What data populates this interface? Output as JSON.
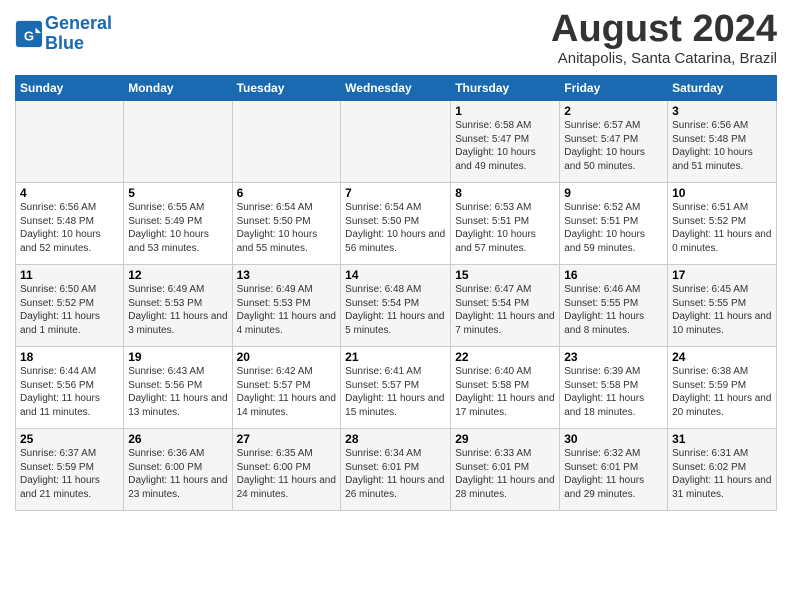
{
  "header": {
    "logo_line1": "General",
    "logo_line2": "Blue",
    "month": "August 2024",
    "location": "Anitapolis, Santa Catarina, Brazil"
  },
  "weekdays": [
    "Sunday",
    "Monday",
    "Tuesday",
    "Wednesday",
    "Thursday",
    "Friday",
    "Saturday"
  ],
  "weeks": [
    [
      {
        "day": "",
        "info": ""
      },
      {
        "day": "",
        "info": ""
      },
      {
        "day": "",
        "info": ""
      },
      {
        "day": "",
        "info": ""
      },
      {
        "day": "1",
        "info": "Sunrise: 6:58 AM\nSunset: 5:47 PM\nDaylight: 10 hours and 49 minutes."
      },
      {
        "day": "2",
        "info": "Sunrise: 6:57 AM\nSunset: 5:47 PM\nDaylight: 10 hours and 50 minutes."
      },
      {
        "day": "3",
        "info": "Sunrise: 6:56 AM\nSunset: 5:48 PM\nDaylight: 10 hours and 51 minutes."
      }
    ],
    [
      {
        "day": "4",
        "info": "Sunrise: 6:56 AM\nSunset: 5:48 PM\nDaylight: 10 hours and 52 minutes."
      },
      {
        "day": "5",
        "info": "Sunrise: 6:55 AM\nSunset: 5:49 PM\nDaylight: 10 hours and 53 minutes."
      },
      {
        "day": "6",
        "info": "Sunrise: 6:54 AM\nSunset: 5:50 PM\nDaylight: 10 hours and 55 minutes."
      },
      {
        "day": "7",
        "info": "Sunrise: 6:54 AM\nSunset: 5:50 PM\nDaylight: 10 hours and 56 minutes."
      },
      {
        "day": "8",
        "info": "Sunrise: 6:53 AM\nSunset: 5:51 PM\nDaylight: 10 hours and 57 minutes."
      },
      {
        "day": "9",
        "info": "Sunrise: 6:52 AM\nSunset: 5:51 PM\nDaylight: 10 hours and 59 minutes."
      },
      {
        "day": "10",
        "info": "Sunrise: 6:51 AM\nSunset: 5:52 PM\nDaylight: 11 hours and 0 minutes."
      }
    ],
    [
      {
        "day": "11",
        "info": "Sunrise: 6:50 AM\nSunset: 5:52 PM\nDaylight: 11 hours and 1 minute."
      },
      {
        "day": "12",
        "info": "Sunrise: 6:49 AM\nSunset: 5:53 PM\nDaylight: 11 hours and 3 minutes."
      },
      {
        "day": "13",
        "info": "Sunrise: 6:49 AM\nSunset: 5:53 PM\nDaylight: 11 hours and 4 minutes."
      },
      {
        "day": "14",
        "info": "Sunrise: 6:48 AM\nSunset: 5:54 PM\nDaylight: 11 hours and 5 minutes."
      },
      {
        "day": "15",
        "info": "Sunrise: 6:47 AM\nSunset: 5:54 PM\nDaylight: 11 hours and 7 minutes."
      },
      {
        "day": "16",
        "info": "Sunrise: 6:46 AM\nSunset: 5:55 PM\nDaylight: 11 hours and 8 minutes."
      },
      {
        "day": "17",
        "info": "Sunrise: 6:45 AM\nSunset: 5:55 PM\nDaylight: 11 hours and 10 minutes."
      }
    ],
    [
      {
        "day": "18",
        "info": "Sunrise: 6:44 AM\nSunset: 5:56 PM\nDaylight: 11 hours and 11 minutes."
      },
      {
        "day": "19",
        "info": "Sunrise: 6:43 AM\nSunset: 5:56 PM\nDaylight: 11 hours and 13 minutes."
      },
      {
        "day": "20",
        "info": "Sunrise: 6:42 AM\nSunset: 5:57 PM\nDaylight: 11 hours and 14 minutes."
      },
      {
        "day": "21",
        "info": "Sunrise: 6:41 AM\nSunset: 5:57 PM\nDaylight: 11 hours and 15 minutes."
      },
      {
        "day": "22",
        "info": "Sunrise: 6:40 AM\nSunset: 5:58 PM\nDaylight: 11 hours and 17 minutes."
      },
      {
        "day": "23",
        "info": "Sunrise: 6:39 AM\nSunset: 5:58 PM\nDaylight: 11 hours and 18 minutes."
      },
      {
        "day": "24",
        "info": "Sunrise: 6:38 AM\nSunset: 5:59 PM\nDaylight: 11 hours and 20 minutes."
      }
    ],
    [
      {
        "day": "25",
        "info": "Sunrise: 6:37 AM\nSunset: 5:59 PM\nDaylight: 11 hours and 21 minutes."
      },
      {
        "day": "26",
        "info": "Sunrise: 6:36 AM\nSunset: 6:00 PM\nDaylight: 11 hours and 23 minutes."
      },
      {
        "day": "27",
        "info": "Sunrise: 6:35 AM\nSunset: 6:00 PM\nDaylight: 11 hours and 24 minutes."
      },
      {
        "day": "28",
        "info": "Sunrise: 6:34 AM\nSunset: 6:01 PM\nDaylight: 11 hours and 26 minutes."
      },
      {
        "day": "29",
        "info": "Sunrise: 6:33 AM\nSunset: 6:01 PM\nDaylight: 11 hours and 28 minutes."
      },
      {
        "day": "30",
        "info": "Sunrise: 6:32 AM\nSunset: 6:01 PM\nDaylight: 11 hours and 29 minutes."
      },
      {
        "day": "31",
        "info": "Sunrise: 6:31 AM\nSunset: 6:02 PM\nDaylight: 11 hours and 31 minutes."
      }
    ]
  ]
}
